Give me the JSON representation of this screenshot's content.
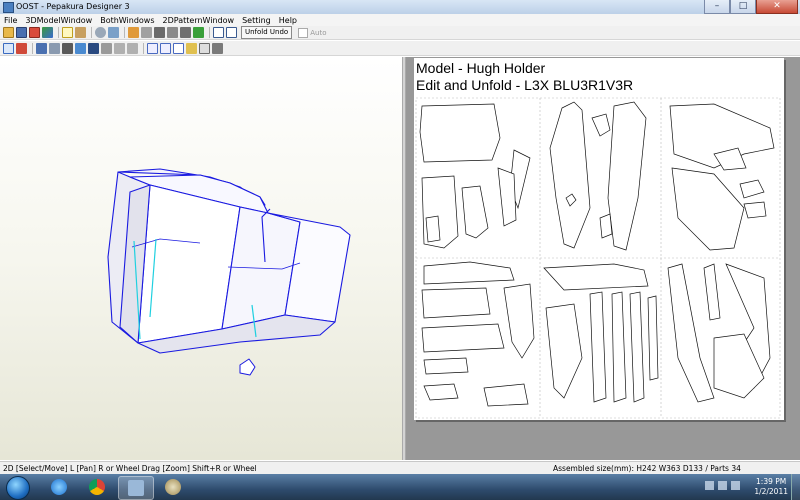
{
  "window": {
    "title": "OOST - Pepakura Designer 3",
    "min": "–",
    "max": "□",
    "close": "✕"
  },
  "menu": [
    "File",
    "3DModelWindow",
    "BothWindows",
    "2DPatternWindow",
    "Setting",
    "Help"
  ],
  "toolbar": {
    "unfold_label": "Unfold Undo",
    "auto_label": "Auto"
  },
  "sheet": {
    "heading1": "Model - Hugh Holder",
    "heading2": "Edit and Unfold - L3X BLU3R1V3R"
  },
  "status": {
    "left": "2D [Select/Move] L [Pan] R or Wheel Drag [Zoom] Shift+R or Wheel",
    "right": "Assembled size(mm): H242 W363 D133 / Parts 34"
  },
  "taskbar": {
    "time": "1:39 PM",
    "date": "1/2/2011"
  },
  "icons": [
    "start-orb-icon",
    "internet-explorer-icon",
    "chrome-icon",
    "pepakura-icon",
    "paint-icon"
  ]
}
